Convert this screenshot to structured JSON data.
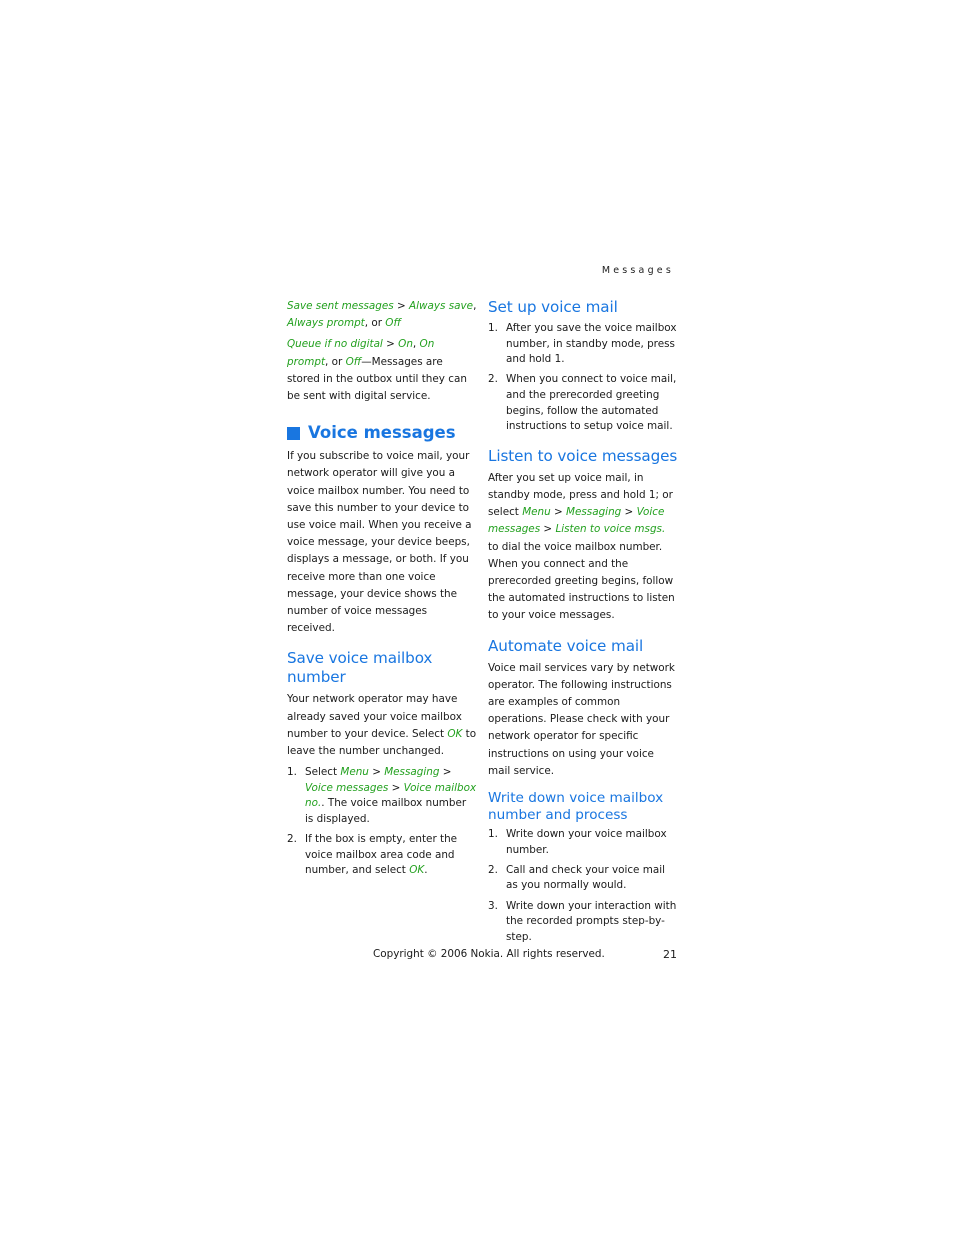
{
  "running_head": "Messages",
  "left": {
    "intro": [
      {
        "parts": [
          {
            "t": "Save sent messages",
            "g": true
          },
          {
            "t": " > "
          },
          {
            "t": "Always save",
            "g": true
          },
          {
            "t": ", "
          },
          {
            "t": "Always prompt",
            "g": true
          },
          {
            "t": ", or "
          },
          {
            "t": "Off",
            "g": true
          }
        ]
      },
      {
        "parts": [
          {
            "t": "Queue if no digital",
            "g": true
          },
          {
            "t": " > "
          },
          {
            "t": "On",
            "g": true
          },
          {
            "t": ", "
          },
          {
            "t": "On prompt",
            "g": true
          },
          {
            "t": ", or "
          },
          {
            "t": "Off",
            "g": true
          },
          {
            "t": "—Messages are stored in the outbox until they can be sent with digital service."
          }
        ]
      }
    ],
    "voice_messages_title": "Voice messages",
    "voice_messages_body": "If you subscribe to voice mail, your network operator will give you a voice mailbox number. You need to save this number to your device to use voice mail. When you receive a voice message, your device beeps, displays a message, or both. If you receive more than one voice message, your device shows the number of voice messages received.",
    "save_title": "Save voice mailbox number",
    "save_body_parts": [
      {
        "t": "Your network operator may have already saved your voice mailbox number to your device. Select "
      },
      {
        "t": "OK",
        "g": true
      },
      {
        "t": " to leave the number unchanged."
      }
    ],
    "save_steps": [
      {
        "num": "1.",
        "parts": [
          {
            "t": "Select "
          },
          {
            "t": "Menu",
            "g": true
          },
          {
            "t": " > "
          },
          {
            "t": "Messaging",
            "g": true
          },
          {
            "t": " > "
          },
          {
            "t": "Voice messages",
            "g": true
          },
          {
            "t": " > "
          },
          {
            "t": "Voice mailbox no.",
            "g": true
          },
          {
            "t": ". The voice mailbox number is displayed."
          }
        ]
      },
      {
        "num": "2.",
        "parts": [
          {
            "t": "If the box is empty, enter the voice mailbox area code and number, and select "
          },
          {
            "t": "OK",
            "g": true
          },
          {
            "t": "."
          }
        ]
      }
    ]
  },
  "right": {
    "setup_title": "Set up voice mail",
    "setup_steps": [
      {
        "num": "1.",
        "text": "After you save the voice mailbox number, in standby mode, press and hold 1."
      },
      {
        "num": "2.",
        "text": "When you connect to voice mail, and the prerecorded greeting begins, follow the automated instructions to setup voice mail."
      }
    ],
    "listen_title": "Listen to voice messages",
    "listen_parts": [
      {
        "t": "After you set up voice mail, in standby mode, press and hold 1; or select "
      },
      {
        "t": "Menu",
        "g": true
      },
      {
        "t": " > "
      },
      {
        "t": "Messaging",
        "g": true
      },
      {
        "t": " > "
      },
      {
        "t": "Voice messages",
        "g": true
      },
      {
        "t": " > "
      },
      {
        "t": "Listen to voice msgs.",
        "g": true
      },
      {
        "t": " to dial the voice mailbox number. When you connect and the prerecorded greeting begins, follow the automated instructions to listen to your voice messages."
      }
    ],
    "automate_title": "Automate voice mail",
    "automate_body": "Voice mail services vary by network operator. The following instructions are examples of common operations. Please check with your network operator for specific instructions on using your voice mail service.",
    "write_title": "Write down voice mailbox number and process",
    "write_steps": [
      {
        "num": "1.",
        "text": "Write down your voice mailbox number."
      },
      {
        "num": "2.",
        "text": "Call and check your voice mail as you normally would."
      },
      {
        "num": "3.",
        "text": "Write down your interaction with the recorded prompts step-by-step."
      }
    ]
  },
  "footer": {
    "copyright": "Copyright © 2006 Nokia. All rights reserved.",
    "page_number": "21"
  },
  "colors": {
    "heading": "#1976e0",
    "menu_path": "#22a01e",
    "text": "#1a1a1a"
  }
}
